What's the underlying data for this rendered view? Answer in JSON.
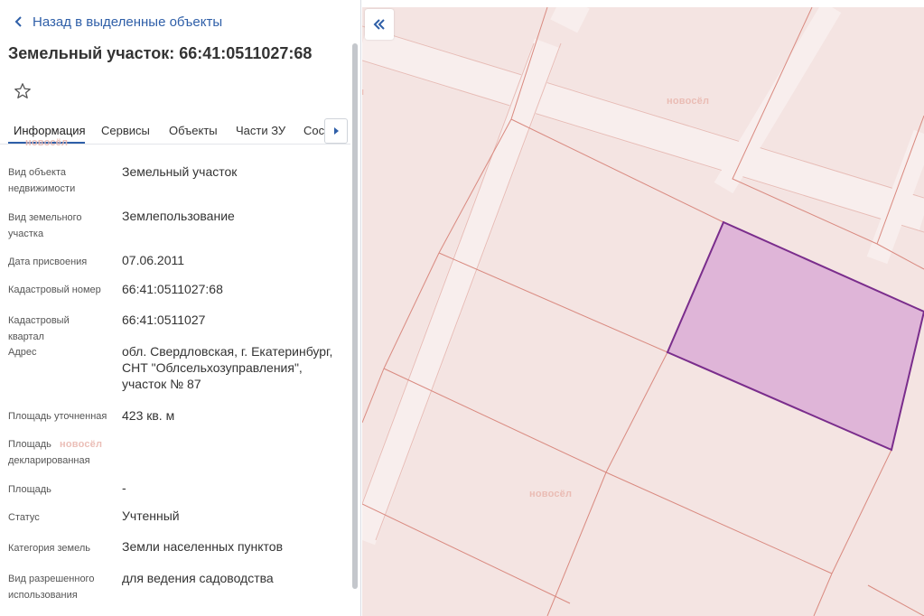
{
  "back_link": {
    "label": "Назад в выделенные объекты",
    "icon": "chevron-left-icon"
  },
  "title": "Земельный участок: 66:41:0511027:68",
  "favorite_icon": "star-outline-icon",
  "tabs": [
    {
      "label": "Информация",
      "active": true
    },
    {
      "label": "Сервисы",
      "active": false
    },
    {
      "label": "Объекты",
      "active": false
    },
    {
      "label": "Части ЗУ",
      "active": false
    },
    {
      "label": "Сост",
      "active": false
    }
  ],
  "tabs_next_icon": "chevron-right-icon",
  "info_rows": [
    {
      "label": "Вид объекта недвижимости",
      "value": "Земельный участок"
    },
    {
      "label": "Вид земельного участка",
      "value": "Землепользование"
    },
    {
      "label": "Дата присвоения",
      "value": "07.06.2011"
    },
    {
      "label": "Кадастровый номер",
      "value": "66:41:0511027:68"
    },
    {
      "label": "Кадастровый квартал",
      "value": "66:41:0511027"
    },
    {
      "label": "Адрес",
      "value": "обл. Свердловская, г. Екатеринбург, СНТ \"Облсельхозуправления\", участок № 87"
    },
    {
      "label": "Площадь уточненная",
      "value": "423 кв. м"
    },
    {
      "label": "Площадь декларированная",
      "value": ""
    },
    {
      "label": "Площадь",
      "value": "-"
    },
    {
      "label": "Статус",
      "value": "Учтенный"
    },
    {
      "label": "Категория земель",
      "value": "Земли населенных пунктов"
    },
    {
      "label": "Вид разрешенного использования",
      "value": "для ведения садоводства"
    }
  ],
  "map": {
    "collapse_icon": "double-chevron-left-icon",
    "background_color": "#f4e4e2",
    "parcel_line_color": "#d98a80",
    "selected_fill_color": "#dfb5d8",
    "selected_stroke_color": "#7a2d8c"
  },
  "watermark": {
    "text": "новосёл"
  },
  "colors": {
    "accent": "#2f5fa8"
  }
}
